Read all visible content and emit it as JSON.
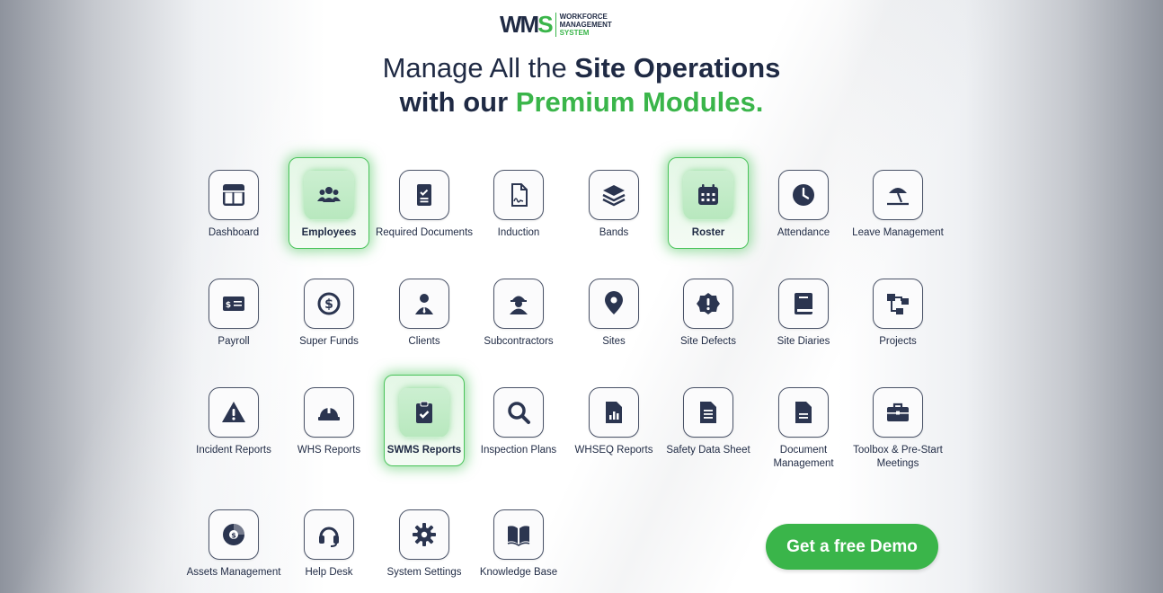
{
  "logo": {
    "mark_w": "W",
    "mark_m": "M",
    "mark_s": "S",
    "line1": "WORKFORCE",
    "line2": "MANAGEMENT",
    "line3": "SYSTEM"
  },
  "heading": {
    "line1_normal": "Manage All the ",
    "line1_bold": "Site Operations",
    "line2_bold": "with our ",
    "line2_green": "Premium Modules."
  },
  "modules": [
    {
      "label": "Dashboard",
      "icon": "dashboard-icon"
    },
    {
      "label": "Employees",
      "icon": "users-icon",
      "highlighted": true
    },
    {
      "label": "Required Documents",
      "icon": "checklist-icon"
    },
    {
      "label": "Induction",
      "icon": "signed-document-icon"
    },
    {
      "label": "Bands",
      "icon": "layers-icon"
    },
    {
      "label": "Roster",
      "icon": "calendar-icon",
      "highlighted": true
    },
    {
      "label": "Attendance",
      "icon": "clock-icon"
    },
    {
      "label": "Leave Management",
      "icon": "beach-umbrella-icon"
    },
    {
      "label": "Payroll",
      "icon": "payroll-icon"
    },
    {
      "label": "Super Funds",
      "icon": "dollar-refresh-icon"
    },
    {
      "label": "Clients",
      "icon": "client-icon"
    },
    {
      "label": "Subcontractors",
      "icon": "worker-icon"
    },
    {
      "label": "Sites",
      "icon": "map-pin-icon"
    },
    {
      "label": "Site Defects",
      "icon": "alert-badge-icon"
    },
    {
      "label": "Site Diaries",
      "icon": "book-icon"
    },
    {
      "label": "Projects",
      "icon": "project-tree-icon"
    },
    {
      "label": "Incident Reports",
      "icon": "warning-icon"
    },
    {
      "label": "WHS Reports",
      "icon": "hard-hat-icon"
    },
    {
      "label": "SWMS Reports",
      "icon": "clipboard-check-icon",
      "highlighted": true
    },
    {
      "label": "Inspection Plans",
      "icon": "magnifier-icon"
    },
    {
      "label": "WHSEQ Reports",
      "icon": "chart-document-icon"
    },
    {
      "label": "Safety Data Sheet",
      "icon": "text-document-icon"
    },
    {
      "label": "Document Management",
      "icon": "document-icon"
    },
    {
      "label": "Toolbox & Pre-Start Meetings",
      "icon": "toolbox-icon"
    },
    {
      "label": "Assets Management",
      "icon": "asset-pie-icon"
    },
    {
      "label": "Help Desk",
      "icon": "headset-icon"
    },
    {
      "label": "System Settings",
      "icon": "gear-icon"
    },
    {
      "label": "Knowledge Base",
      "icon": "open-book-icon"
    }
  ],
  "cta": {
    "label": "Get a free Demo"
  },
  "colors": {
    "accent": "#3ab54a",
    "navy": "#1f2a44"
  }
}
